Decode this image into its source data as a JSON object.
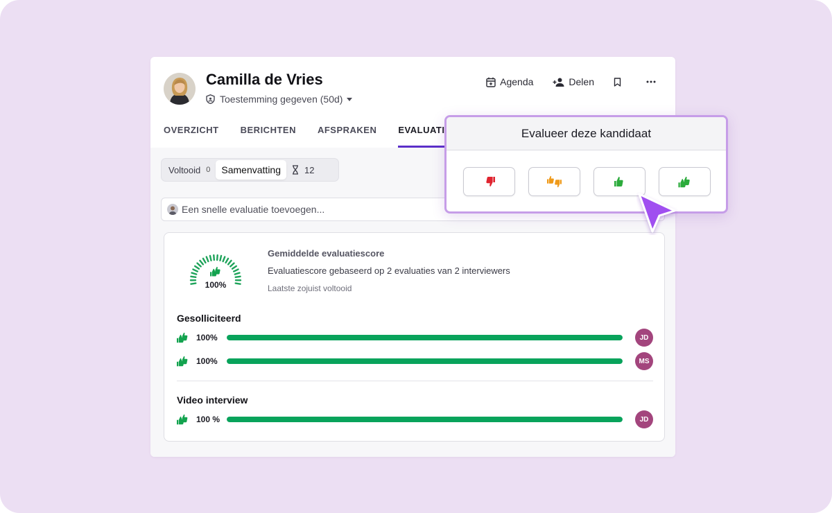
{
  "candidate": {
    "name": "Camilla de Vries",
    "consent": "Toestemming gegeven (50d)"
  },
  "actions": {
    "agenda": "Agenda",
    "share": "Delen"
  },
  "tabs": [
    "OVERZICHT",
    "BERICHTEN",
    "AFSPRAKEN",
    "EVALUATIE"
  ],
  "active_tab": "EVALUATIE",
  "segments": {
    "completed_label": "Voltooid",
    "completed_count": "0",
    "summary_label": "Samenvatting",
    "pending_count": "12"
  },
  "quick_eval": {
    "placeholder": "Een snelle evaluatie toevoegen..."
  },
  "score": {
    "title": "Gemiddelde evaluatiescore",
    "description": "Evaluatiescore gebaseerd op 2 evaluaties van 2 interviewers",
    "last": "Laatste zojuist voltooid",
    "value_label": "100%",
    "value": 1.0
  },
  "sections": [
    {
      "title": "Gesolliciteerd",
      "rows": [
        {
          "pct_label": "100%",
          "value": 1.0,
          "initials": "JD"
        },
        {
          "pct_label": "100%",
          "value": 1.0,
          "initials": "MS"
        }
      ]
    },
    {
      "title": "Video interview",
      "rows": [
        {
          "pct_label": "100 %",
          "value": 1.0,
          "initials": "JD"
        }
      ]
    }
  ],
  "popup": {
    "title": "Evalueer deze kandidaat",
    "buttons": [
      "strong-no-icon",
      "no-icon",
      "yes-icon",
      "strong-yes-icon"
    ]
  },
  "colors": {
    "accent": "#5b2fc9",
    "bar_green": "#08a35b",
    "initials_bg": "#a3457d",
    "red": "#e0242f",
    "orange": "#ef9a1a",
    "green": "#2cab3c",
    "cursor": "#a04ff0"
  }
}
